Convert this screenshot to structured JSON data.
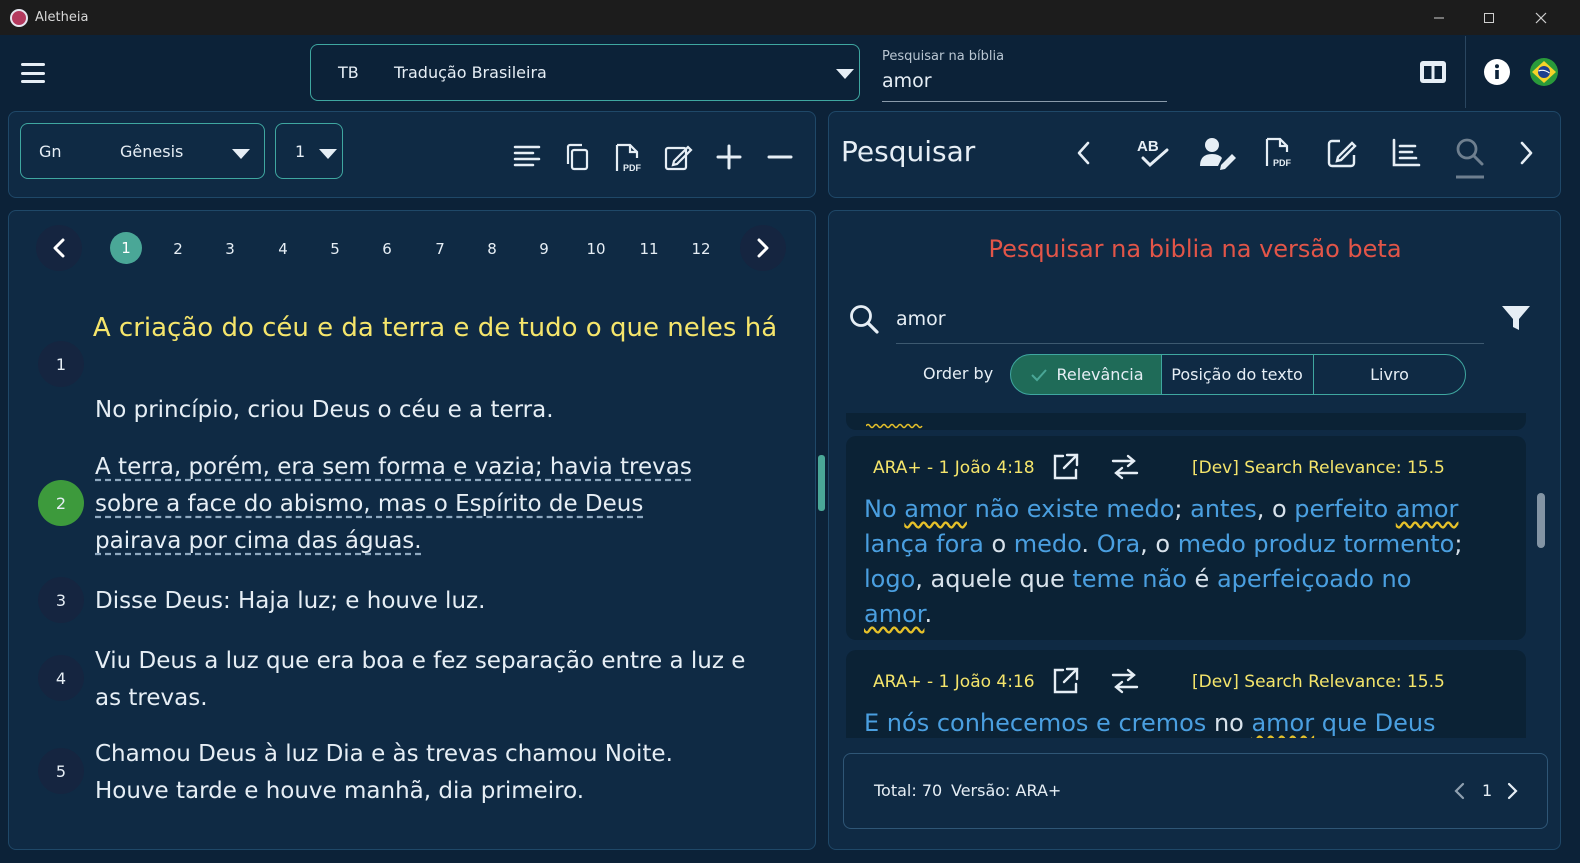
{
  "window": {
    "title": "Aletheia",
    "controls": [
      "minimize",
      "maximize",
      "close"
    ]
  },
  "header": {
    "version_abbr": "TB",
    "version_name": "Tradução Brasileira",
    "search_label": "Pesquisar na bíblia",
    "search_value": "amor",
    "icons": [
      "layout-columns-icon",
      "info-icon",
      "brazil-flag-icon"
    ]
  },
  "reader": {
    "book_abbr": "Gn",
    "book_name": "Gênesis",
    "chapter": "1",
    "tools": [
      "align-left-icon",
      "copy-icon",
      "pdf-icon",
      "edit-note-icon",
      "plus-icon",
      "minus-icon"
    ],
    "chapters": [
      "1",
      "2",
      "3",
      "4",
      "5",
      "6",
      "7",
      "8",
      "9",
      "10",
      "11",
      "12"
    ],
    "active_chapter": "1",
    "section_title": "A criação do céu e da terra e de tudo o que neles há",
    "verses": [
      {
        "num": "1",
        "text": "No princípio, criou Deus o céu e a terra."
      },
      {
        "num": "2",
        "text": "A terra, porém, era sem forma e vazia; havia trevas sobre a face do abismo, mas o Espírito de Deus pairava por cima das águas."
      },
      {
        "num": "3",
        "text": "Disse Deus: Haja luz; e houve luz."
      },
      {
        "num": "4",
        "text": "Viu Deus a luz que era boa e fez separação entre a luz e as trevas."
      },
      {
        "num": "5",
        "text": "Chamou Deus à luz Dia e às trevas chamou Noite. Houve tarde e houve manhã, dia primeiro."
      }
    ]
  },
  "search_panel": {
    "title": "Pesquisar",
    "beta_title": "Pesquisar na biblia na versão beta",
    "query": "amor",
    "order_by_label": "Order by",
    "order_options": [
      "Relevância",
      "Posição do texto",
      "Livro"
    ],
    "active_order": "Relevância",
    "results": [
      {
        "reference": "ARA+ - 1 João 4:18",
        "relevance": "[Dev] Search Relevance: 15.5"
      },
      {
        "reference": "ARA+ - 1 João 4:16",
        "relevance": "[Dev] Search Relevance: 15.5"
      }
    ],
    "total_label": "Total: 70",
    "version_label": "Versão: ARA+",
    "page": "1"
  },
  "colors": {
    "background": "#0c2238",
    "panel": "#0f2a44",
    "accent": "#3fa7a0",
    "title_yellow": "#f5e56b",
    "beta_red": "#e25548",
    "keyword_blue": "#4a9fe0"
  }
}
